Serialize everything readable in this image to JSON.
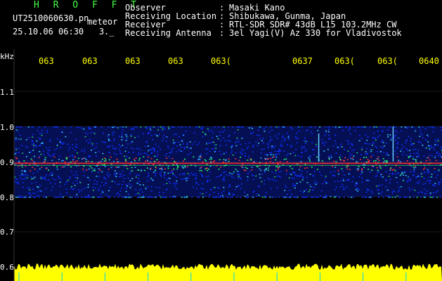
{
  "header": {
    "app_title": "H R O F F T",
    "filename": "UT2510060630.pn",
    "meteor_tag": "meteor",
    "datetime": "25.10.06 06:30   3._",
    "meta": [
      {
        "label": "Observer",
        "value": "Masaki Kano"
      },
      {
        "label": "Receiving Location",
        "value": "Shibukawa, Gunma, Japan"
      },
      {
        "label": "Receiver",
        "value": "RTL-SDR SDR# 43dB L15 103.2MHz CW"
      },
      {
        "label": "Receiving Antenna",
        "value": "3el Yagi(V) Az 330 for Vladivostok"
      }
    ]
  },
  "colors": {
    "background": "#000000",
    "axis_labels": "#ffff00",
    "noise_band": "#0a22b8",
    "echo_line": "#ff3030",
    "bottom_band": "#ffff00",
    "tick_marks": "#00ccff"
  },
  "chart_data": {
    "type": "heatmap",
    "ylabel": "kHz",
    "ylim": [
      0.6,
      1.05
    ],
    "yticks": [
      {
        "value": 1.0,
        "label": "1.0"
      },
      {
        "value": 1.1,
        "label": "1.1"
      },
      {
        "value": 0.9,
        "label": "0.9"
      },
      {
        "value": 0.8,
        "label": "0.8"
      },
      {
        "value": 0.7,
        "label": "0.7"
      },
      {
        "value": 0.6,
        "label": "0.6"
      }
    ],
    "xticks": [
      "063",
      "063",
      "063",
      "063",
      "063(",
      "0637",
      "063(",
      "063(",
      "0640"
    ],
    "grid": true,
    "noise_band_khz": [
      0.8,
      1.0
    ],
    "echo_line_khz": 0.895,
    "meteor_echoes": [
      {
        "minute": 6.97,
        "khz_top": 0.98,
        "khz_bottom": 0.9
      },
      {
        "minute": 8.7,
        "khz_top": 1.0,
        "khz_bottom": 0.9
      }
    ]
  }
}
